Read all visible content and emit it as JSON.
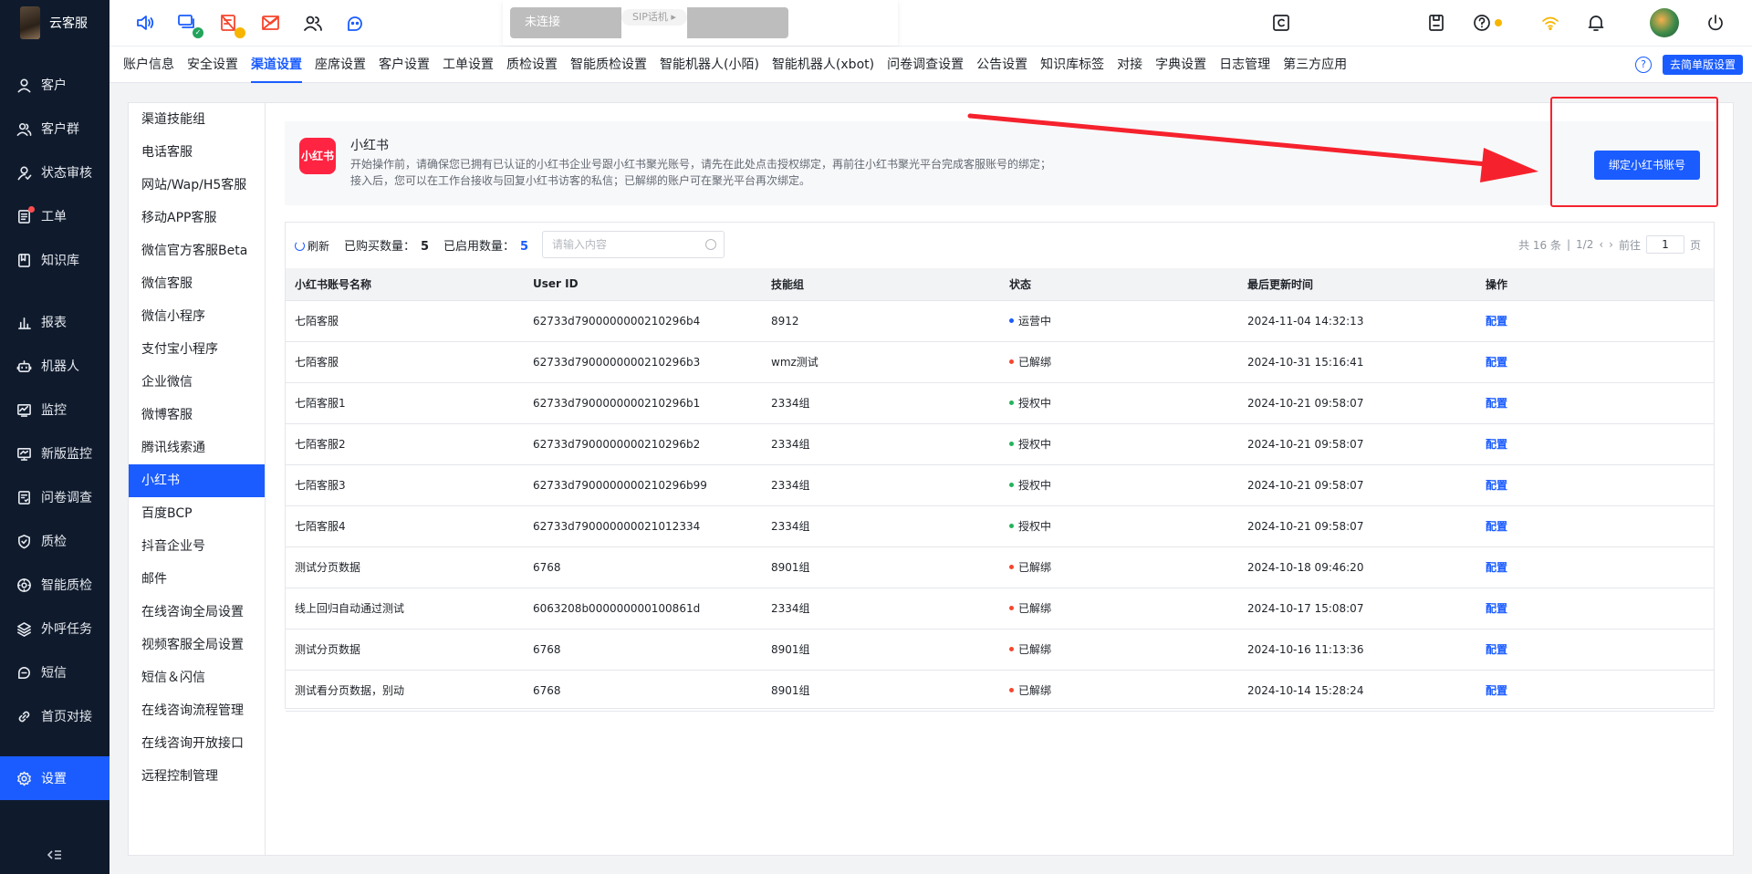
{
  "brand": {
    "name": "云客服"
  },
  "leftnav": {
    "items": [
      {
        "label": "客户",
        "icon": "user-icon"
      },
      {
        "label": "客户群",
        "icon": "users-icon"
      },
      {
        "label": "状态审核",
        "icon": "status-review-icon"
      },
      {
        "label": "工单",
        "icon": "ticket-icon",
        "dot": true
      },
      {
        "label": "知识库",
        "icon": "book-icon"
      },
      {
        "label": "报表",
        "icon": "bar-chart-icon"
      },
      {
        "label": "机器人",
        "icon": "robot-icon"
      },
      {
        "label": "监控",
        "icon": "monitor-icon"
      },
      {
        "label": "新版监控",
        "icon": "screen-monitor-icon"
      },
      {
        "label": "问卷调查",
        "icon": "survey-icon"
      },
      {
        "label": "质检",
        "icon": "shield-icon"
      },
      {
        "label": "智能质检",
        "icon": "smart-check-icon"
      },
      {
        "label": "外呼任务",
        "icon": "layers-icon"
      },
      {
        "label": "短信",
        "icon": "sms-icon"
      },
      {
        "label": "首页对接",
        "icon": "link-icon"
      },
      {
        "label": "设置",
        "icon": "gear-icon",
        "active": true
      }
    ]
  },
  "topbar": {
    "sip_status": "未连接",
    "sip_label": "SIP话机 ▸"
  },
  "tabs": [
    "账户信息",
    "安全设置",
    "渠道设置",
    "座席设置",
    "客户设置",
    "工单设置",
    "质检设置",
    "智能质检设置",
    "智能机器人(小陌)",
    "智能机器人(xbot)",
    "问卷调查设置",
    "公告设置",
    "知识库标签",
    "对接",
    "字典设置",
    "日志管理",
    "第三方应用"
  ],
  "active_tab": "渠道设置",
  "simple_version_btn": "去简单版设置",
  "submenu": {
    "items": [
      "渠道技能组",
      "电话客服",
      "网站/Wap/H5客服",
      "移动APP客服",
      "微信官方客服Beta",
      "微信客服",
      "微信小程序",
      "支付宝小程序",
      "企业微信",
      "微博客服",
      "腾讯线索通",
      "小红书",
      "百度BCP",
      "抖音企业号",
      "邮件",
      "在线咨询全局设置",
      "视频客服全局设置",
      "短信＆闪信",
      "在线咨询流程管理",
      "在线咨询开放接口",
      "远程控制管理"
    ],
    "active": "小红书"
  },
  "intro": {
    "logo_text": "小红书",
    "title": "小红书",
    "desc1": "开始操作前，请确保您已拥有已认证的小红书企业号跟小红书聚光账号，请先在此处点击授权绑定，再前往小红书聚光平台完成客服账号的绑定；",
    "desc2": "接入后，您可以在工作台接收与回复小红书访客的私信；已解绑的账户可在聚光平台再次绑定。",
    "bind_button": "绑定小红书账号"
  },
  "toolbar": {
    "refresh": "刷新",
    "purchased_label": "已购买数量：",
    "purchased_value": "5",
    "enabled_label": "已启用数量：",
    "enabled_value": "5",
    "search_placeholder": "请输入内容"
  },
  "pager": {
    "total": "共 16 条",
    "page": "1/2",
    "goto": "前往",
    "page_input": "1",
    "unit": "页"
  },
  "table": {
    "columns": [
      "小红书账号名称",
      "User ID",
      "技能组",
      "状态",
      "最后更新时间",
      "操作"
    ],
    "rows": [
      [
        "七陌客服",
        "62733d7900000000210296b4",
        "8912",
        "运营中",
        "2024-11-04 14:32:13",
        "配置"
      ],
      [
        "七陌客服",
        "62733d7900000000210296b3",
        "wmz测试",
        "已解绑",
        "2024-10-31 15:16:41",
        "配置"
      ],
      [
        "七陌客服1",
        "62733d7900000000210296b1",
        "2334组",
        "授权中",
        "2024-10-21 09:58:07",
        "配置"
      ],
      [
        "七陌客服2",
        "62733d7900000000210296b2",
        "2334组",
        "授权中",
        "2024-10-21 09:58:07",
        "配置"
      ],
      [
        "七陌客服3",
        "62733d7900000000210296b99",
        "2334组",
        "授权中",
        "2024-10-21 09:58:07",
        "配置"
      ],
      [
        "七陌客服4",
        "62733d790000000021012334",
        "2334组",
        "授权中",
        "2024-10-21 09:58:07",
        "配置"
      ],
      [
        "测试分页数据",
        "6768",
        "8901组",
        "已解绑",
        "2024-10-18 09:46:20",
        "配置"
      ],
      [
        "线上回归自动通过测试",
        "6063208b000000000100861d",
        "2334组",
        "已解绑",
        "2024-10-17 15:08:07",
        "配置"
      ],
      [
        "测试分页数据",
        "6768",
        "8901组",
        "已解绑",
        "2024-10-16 11:13:36",
        "配置"
      ],
      [
        "测试看分页数据，别动",
        "6768",
        "8901组",
        "已解绑",
        "2024-10-14 15:28:24",
        "配置"
      ]
    ]
  },
  "status_colors": {
    "运营中": "#1a5cff",
    "已解绑": "#f5462d",
    "授权中": "#22b35e"
  },
  "colors": {
    "accent": "#1a5cff",
    "nav_bg": "#0f1b2d",
    "annotation": "#f5222d"
  }
}
